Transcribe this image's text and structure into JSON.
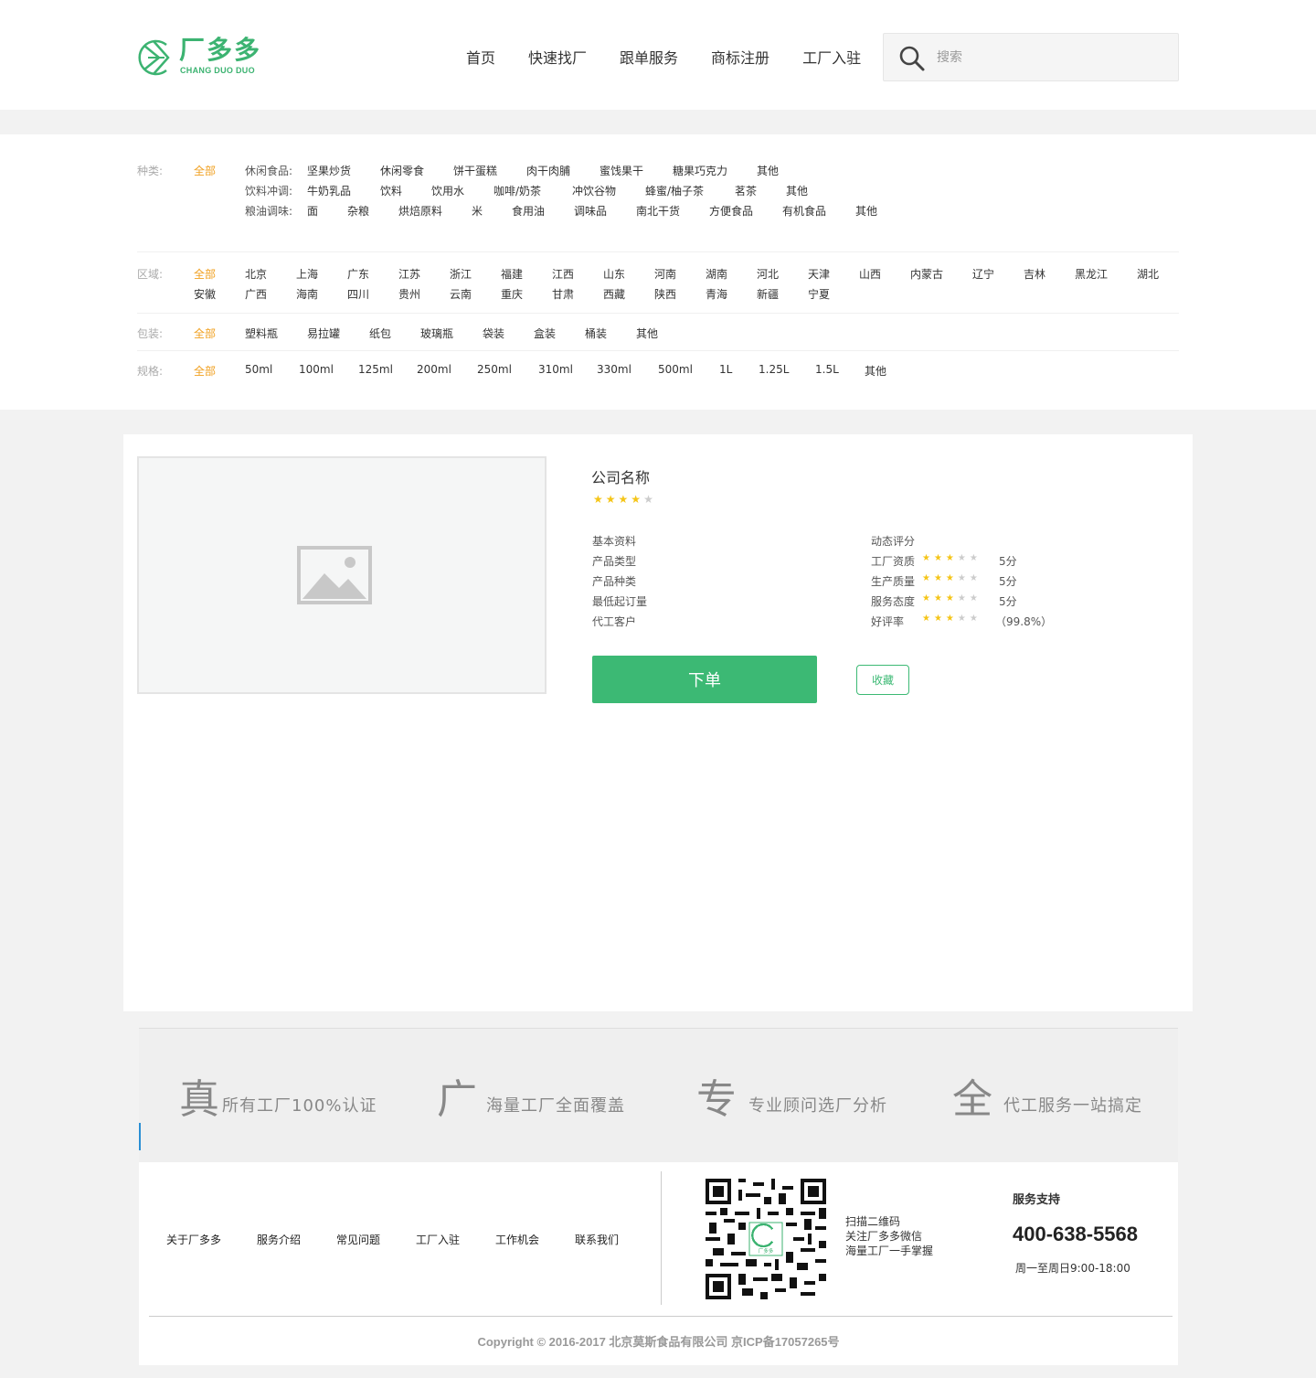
{
  "brand": {
    "name": "厂多多",
    "sub": "CHANG DUO DUO",
    "color": "#3cb371"
  },
  "nav": [
    "首页",
    "快速找厂",
    "跟单服务",
    "商标注册",
    "工厂入驻"
  ],
  "search": {
    "placeholder": "搜索"
  },
  "filters": {
    "category": {
      "label": "种类:",
      "all": "全部",
      "rows": [
        {
          "group": "休闲食品:",
          "items": [
            "坚果炒货",
            "休闲零食",
            "饼干蛋糕",
            "肉干肉脯",
            "蜜饯果干",
            "糖果巧克力",
            "其他"
          ]
        },
        {
          "group": "饮料冲调:",
          "items": [
            "牛奶乳品",
            "饮料",
            "饮用水",
            "咖啡/奶茶",
            "冲饮谷物",
            "蜂蜜/柚子茶",
            "茗茶",
            "其他"
          ]
        },
        {
          "group": "粮油调味:",
          "items": [
            "面",
            "杂粮",
            "烘焙原料",
            "米",
            "食用油",
            "调味品",
            "南北干货",
            "方便食品",
            "有机食品",
            "其他"
          ]
        }
      ]
    },
    "region": {
      "label": "区域:",
      "all": "全部",
      "row1": [
        "北京",
        "上海",
        "广东",
        "江苏",
        "浙江",
        "福建",
        "江西",
        "山东",
        "河南",
        "湖南",
        "河北",
        "天津",
        "山西",
        "内蒙古",
        "辽宁",
        "吉林",
        "黑龙江",
        "湖北"
      ],
      "row2": [
        "安徽",
        "广西",
        "海南",
        "四川",
        "贵州",
        "云南",
        "重庆",
        "甘肃",
        "西藏",
        "陕西",
        "青海",
        "新疆",
        "宁夏"
      ]
    },
    "package": {
      "label": "包装:",
      "all": "全部",
      "items": [
        "塑料瓶",
        "易拉罐",
        "纸包",
        "玻璃瓶",
        "袋装",
        "盒装",
        "桶装",
        "其他"
      ]
    },
    "spec": {
      "label": "规格:",
      "all": "全部",
      "items": [
        "50ml",
        "100ml",
        "125ml",
        "200ml",
        "250ml",
        "310ml",
        "330ml",
        "500ml",
        "1L",
        "1.25L",
        "1.5L",
        "其他"
      ]
    }
  },
  "product": {
    "company": "公司名称",
    "rating": 4,
    "basic": [
      "基本资料",
      "产品类型",
      "产品种类",
      "最低起订量",
      "代工客户"
    ],
    "dynamic_title": "动态评分",
    "scores": [
      {
        "label": "工厂资质",
        "stars": 3,
        "value": "5分"
      },
      {
        "label": "生产质量",
        "stars": 3,
        "value": "5分"
      },
      {
        "label": "服务态度",
        "stars": 3,
        "value": "5分"
      },
      {
        "label": "好评率",
        "stars": 3,
        "value": "（99.8%）"
      }
    ],
    "order_label": "下单",
    "fav_label": "收藏"
  },
  "features": [
    {
      "big": "真",
      "text": "所有工厂100%认证"
    },
    {
      "big": "广",
      "text": "海量工厂全面覆盖"
    },
    {
      "big": "专",
      "text": "专业顾问选厂分析"
    },
    {
      "big": "全",
      "text": "代工服务一站搞定"
    }
  ],
  "footer": {
    "links": [
      "关于厂多多",
      "服务介绍",
      "常见问题",
      "工厂入驻",
      "工作机会",
      "联系我们"
    ],
    "scan": [
      "扫描二维码",
      "关注厂多多微信",
      "海量工厂一手掌握"
    ],
    "qr_badge": "厂多多",
    "service_title": "服务支持",
    "phone": "400-638-5568",
    "hours": "周一至周日9:00-18:00",
    "copyright": "Copyright © 2016-2017 北京莫斯食品有限公司 京ICP备17057265号"
  }
}
